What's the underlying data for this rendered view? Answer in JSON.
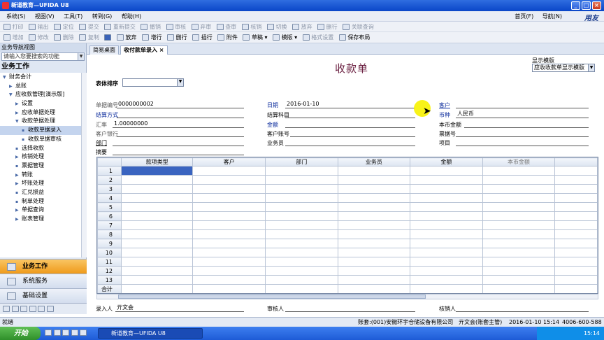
{
  "window": {
    "title": "新道教育—UFIDA U8"
  },
  "menu": [
    "系统(S)",
    "视图(V)",
    "工具(T)",
    "转到(G)",
    "帮助(H)"
  ],
  "topright": {
    "home": "首页(F)",
    "nav": "导航(N)",
    "brand": "用友"
  },
  "toolbar1": [
    "打印",
    "输出",
    "定位",
    "提交",
    "重新提交",
    "撤销",
    "审核",
    "弃审",
    "查审",
    "核销",
    "切换",
    "放弃",
    "删行",
    "关联查询"
  ],
  "toolbar2": [
    "增加",
    "修改",
    "删除",
    "复制",
    "放弃",
    "增行",
    "删行",
    "插行",
    "附件",
    "草稿",
    "模版",
    "格式设置",
    "保存布局"
  ],
  "nav": {
    "header": "业务导航视图",
    "search_placeholder": "请输入您要搜索的功能",
    "title": "业务工作",
    "items": [
      {
        "label": "财务会计",
        "level": 0,
        "arrow": "▼"
      },
      {
        "label": "总账",
        "level": 1,
        "arrow": "▶"
      },
      {
        "label": "应收款管理[演示版]",
        "level": 1,
        "arrow": "▼"
      },
      {
        "label": "设置",
        "level": 2,
        "arrow": "▶"
      },
      {
        "label": "应收单据处理",
        "level": 2,
        "arrow": "▶"
      },
      {
        "label": "收款单据处理",
        "level": 2,
        "arrow": "▼"
      },
      {
        "label": "收款单据录入",
        "level": 3,
        "arrow": "",
        "selected": true
      },
      {
        "label": "收款单据审核",
        "level": 3,
        "arrow": ""
      },
      {
        "label": "选择收款",
        "level": 2,
        "arrow": ""
      },
      {
        "label": "核销处理",
        "level": 2,
        "arrow": "▶"
      },
      {
        "label": "票据管理",
        "level": 2,
        "arrow": ""
      },
      {
        "label": "转账",
        "level": 2,
        "arrow": "▶"
      },
      {
        "label": "坏账处理",
        "level": 2,
        "arrow": "▶"
      },
      {
        "label": "汇兑损益",
        "level": 2,
        "arrow": ""
      },
      {
        "label": "制单处理",
        "level": 2,
        "arrow": ""
      },
      {
        "label": "单据查询",
        "level": 2,
        "arrow": "▶"
      },
      {
        "label": "账表管理",
        "level": 2,
        "arrow": "▶"
      }
    ],
    "modules": [
      "业务工作",
      "系统服务",
      "基础设置"
    ]
  },
  "tabs": [
    "简易桌面",
    "收付款单录入"
  ],
  "form": {
    "title": "收款单",
    "template_label": "显示模版",
    "template_value": "应收收款单显示模版",
    "sort_label": "表体排序",
    "doc_no_label": "单据编号",
    "doc_no": "0000000002",
    "date_label": "日期",
    "date": "2016-01-10",
    "customer_label": "客户",
    "settle_label": "结算方式",
    "settle_subject_label": "结算科目",
    "currency_label": "币种",
    "currency": "人民币",
    "rate_label": "汇率",
    "rate": "1.00000000",
    "amount_label": "金额",
    "local_amount_label": "本币金额",
    "bank_label": "客户银行",
    "account_label": "客户账号",
    "note_no_label": "票据号",
    "dept_label": "部门",
    "staff_label": "业务员",
    "project_label": "项目",
    "memo_label": "摘要",
    "columns": [
      "款项类型",
      "客户",
      "部门",
      "业务员",
      "金额",
      "本币金额"
    ],
    "rows": [
      "1",
      "2",
      "3",
      "4",
      "5",
      "6",
      "7",
      "8",
      "9",
      "10",
      "11",
      "12",
      "13"
    ],
    "total_label": "合计",
    "entry_label": "录入人",
    "entry_user": "亓文会",
    "audit_label": "审核人",
    "verify_label": "核销人"
  },
  "status": {
    "left": "就绪",
    "account": "账套:(001)安徽环宇仓储设备有限公司",
    "user": "亓文会(账套主管)",
    "date": "2016-01-10 15:14",
    "phone": "4006-600-588"
  },
  "taskbar": {
    "start": "开始",
    "task": "新道教育—UFIDA U8",
    "time": "15:14"
  }
}
